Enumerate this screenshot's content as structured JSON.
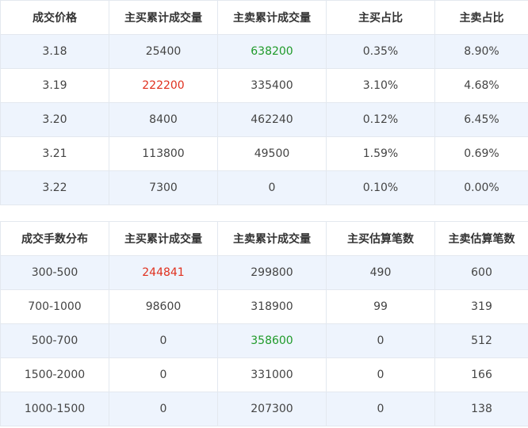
{
  "price_table": {
    "headers": [
      "成交价格",
      "主买累计成交量",
      "主卖累计成交量",
      "主买占比",
      "主卖占比"
    ],
    "rows": [
      [
        "3.18",
        "25400",
        "638200",
        "0.35%",
        "8.90%"
      ],
      [
        "3.19",
        "222200",
        "335400",
        "3.10%",
        "4.68%"
      ],
      [
        "3.20",
        "8400",
        "462240",
        "0.12%",
        "6.45%"
      ],
      [
        "3.21",
        "113800",
        "49500",
        "1.59%",
        "0.69%"
      ],
      [
        "3.22",
        "7300",
        "0",
        "0.10%",
        "0.00%"
      ]
    ]
  },
  "lot_table": {
    "headers": [
      "成交手数分布",
      "主买累计成交量",
      "主卖累计成交量",
      "主买估算笔数",
      "主卖估算笔数"
    ],
    "rows": [
      [
        "300-500",
        "244841",
        "299800",
        "490",
        "600"
      ],
      [
        "700-1000",
        "98600",
        "318900",
        "99",
        "319"
      ],
      [
        "500-700",
        "0",
        "358600",
        "0",
        "512"
      ],
      [
        "1500-2000",
        "0",
        "331000",
        "0",
        "166"
      ],
      [
        "1000-1500",
        "0",
        "207300",
        "0",
        "138"
      ]
    ]
  },
  "colors": {
    "highlight_red": "#e0301e",
    "highlight_green": "#1f9a2a",
    "stripe": "#eef4fd",
    "border": "#e3e8ef"
  }
}
